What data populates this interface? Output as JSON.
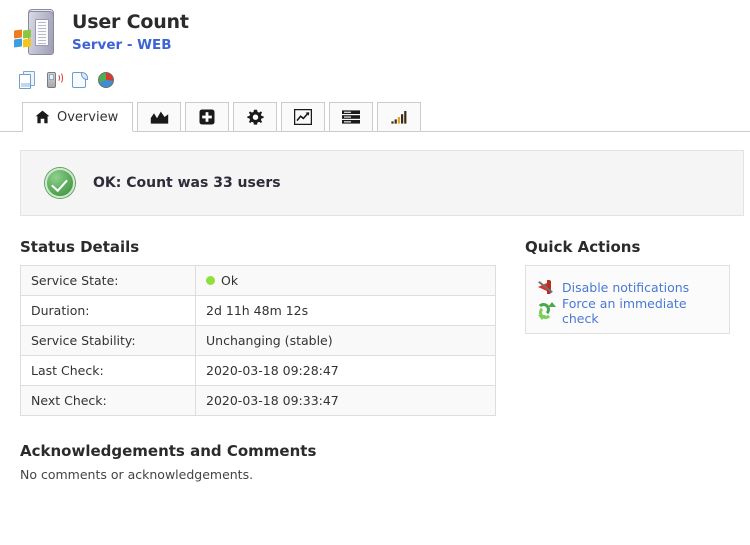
{
  "header": {
    "title": "User Count",
    "subtitle": "Server - WEB",
    "icon": "windows-server-icon"
  },
  "action_icons": [
    {
      "name": "duplicate-service-icon",
      "label": ""
    },
    {
      "name": "notifications-device-icon",
      "label": ""
    },
    {
      "name": "service-log-icon",
      "label": ""
    },
    {
      "name": "reports-pie-icon",
      "label": ""
    }
  ],
  "tabs": [
    {
      "name": "tab-overview",
      "label": "Overview",
      "icon": "home-icon",
      "active": true
    },
    {
      "name": "tab-area-graph",
      "label": "",
      "icon": "area-chart-icon",
      "active": false
    },
    {
      "name": "tab-add",
      "label": "",
      "icon": "plus-square-icon",
      "active": false
    },
    {
      "name": "tab-settings",
      "label": "",
      "icon": "gear-icon",
      "active": false
    },
    {
      "name": "tab-trends",
      "label": "",
      "icon": "line-chart-icon",
      "active": false
    },
    {
      "name": "tab-list",
      "label": "",
      "icon": "server-list-icon",
      "active": false
    },
    {
      "name": "tab-signal",
      "label": "",
      "icon": "signal-bars-icon",
      "active": false
    }
  ],
  "status_banner": {
    "icon": "ok-check-circle-icon",
    "text": "OK: Count was 33 users"
  },
  "status_details": {
    "title": "Status Details",
    "rows": [
      {
        "key": "Service State:",
        "value": "Ok",
        "has_dot": true
      },
      {
        "key": "Duration:",
        "value": "2d 11h 48m 12s",
        "has_dot": false
      },
      {
        "key": "Service Stability:",
        "value": "Unchanging (stable)",
        "has_dot": false
      },
      {
        "key": "Last Check:",
        "value": "2020-03-18 09:28:47",
        "has_dot": false
      },
      {
        "key": "Next Check:",
        "value": "2020-03-18 09:33:47",
        "has_dot": false
      }
    ]
  },
  "quick_actions": {
    "title": "Quick Actions",
    "items": [
      {
        "label": "Disable notifications",
        "icon": "mute-notifications-icon"
      },
      {
        "label": "Force an immediate check",
        "icon": "refresh-arrows-icon"
      }
    ]
  },
  "acknowledgements": {
    "title": "Acknowledgements and Comments",
    "text": "No comments or acknowledgements."
  },
  "colors": {
    "ok_green": "#5cb85c",
    "state_dot_green": "#8ee03c",
    "link_blue": "#4a79d4",
    "subtitle_blue": "#3b63d6",
    "banner_bg": "#f5f5f5",
    "border_grey": "#dddddd"
  }
}
